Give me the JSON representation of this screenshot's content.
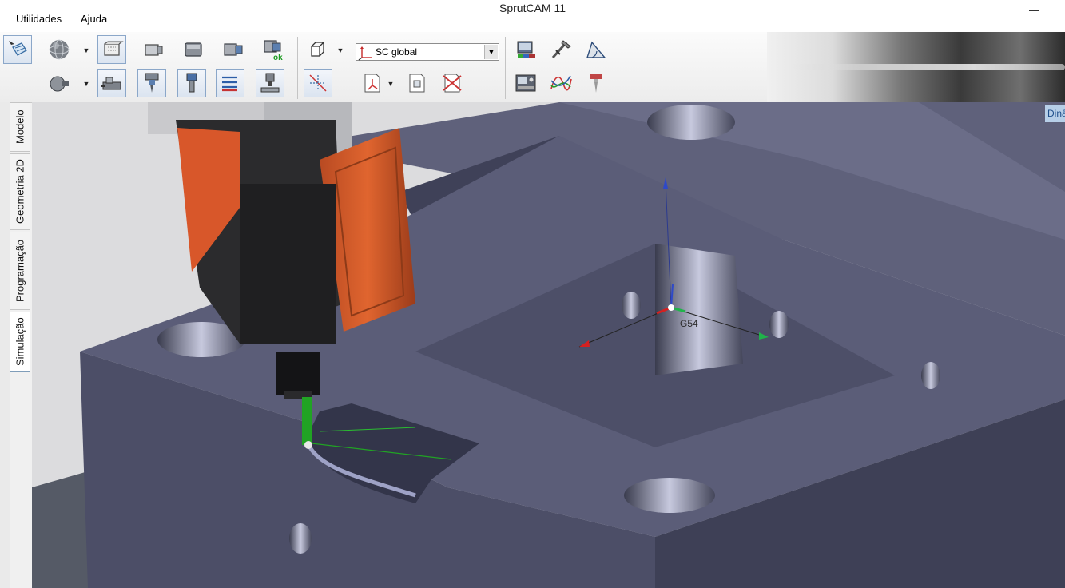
{
  "window": {
    "title": "SprutCAM 11"
  },
  "menu": {
    "items": [
      "Utilidades",
      "Ajuda"
    ]
  },
  "toolbar": {
    "coordinate_system": {
      "selected": "SC global"
    }
  },
  "side_tabs": [
    "Modelo",
    "Geometria 2D",
    "Programação",
    "Simulação"
  ],
  "active_side_tab": "Simulação",
  "viewport": {
    "dynamic_tab_label": "Dinâ",
    "origin_label": "G54",
    "colors": {
      "workpiece": "#5c5e78",
      "spindle_head": "#d8572a",
      "tool_path": "#21a324"
    }
  }
}
